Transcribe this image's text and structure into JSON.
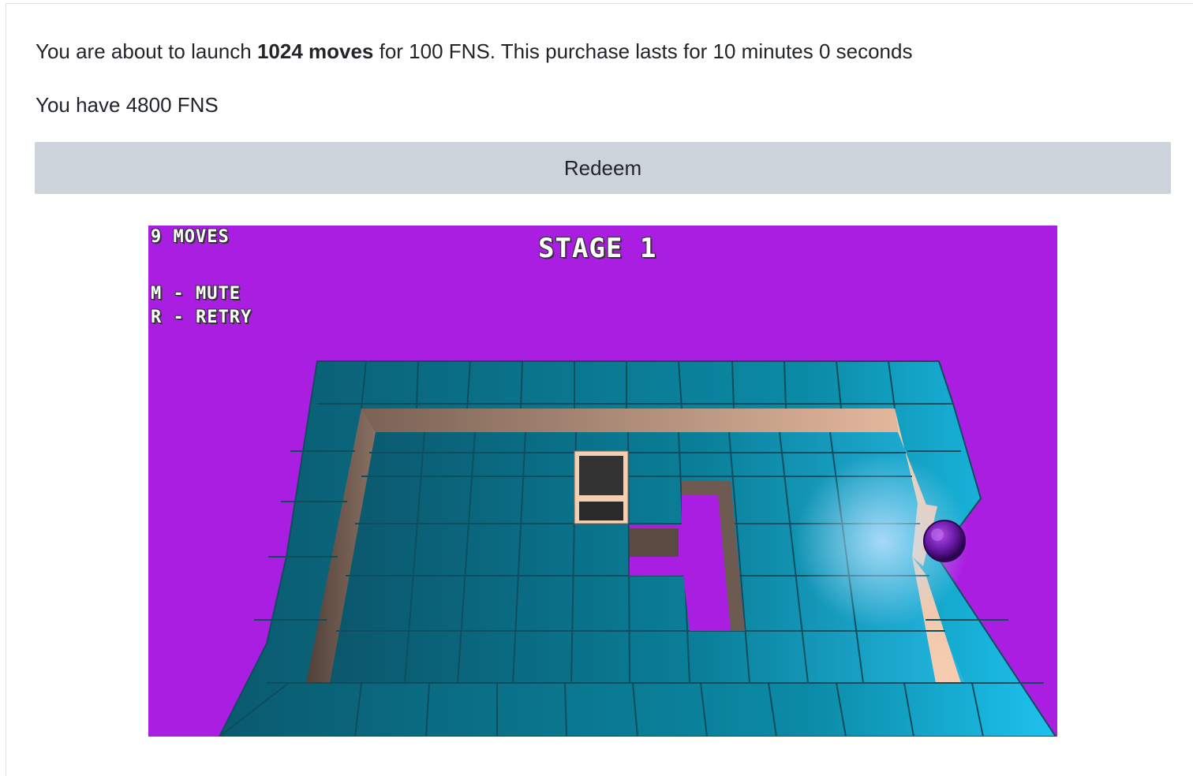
{
  "purchase": {
    "prefix": "You are about to launch ",
    "moves": "1024 moves",
    "suffix": " for 100 FNS. This purchase lasts for 10 minutes 0 seconds"
  },
  "balance": "You have 4800 FNS",
  "redeem_label": "Redeem",
  "game": {
    "moves_counter": "9 MOVES",
    "stage_title": "STAGE 1",
    "mute_hint": "M - MUTE",
    "retry_hint": "R - RETRY",
    "colors": {
      "background": "#a91ee0",
      "tile": "#0a7f99",
      "tile_edge": "#0f4c5c",
      "wall_face": "#c9a58f",
      "box_top": "#333333",
      "box_frame": "#f3d0b3",
      "player": "#6a1aa8"
    }
  }
}
